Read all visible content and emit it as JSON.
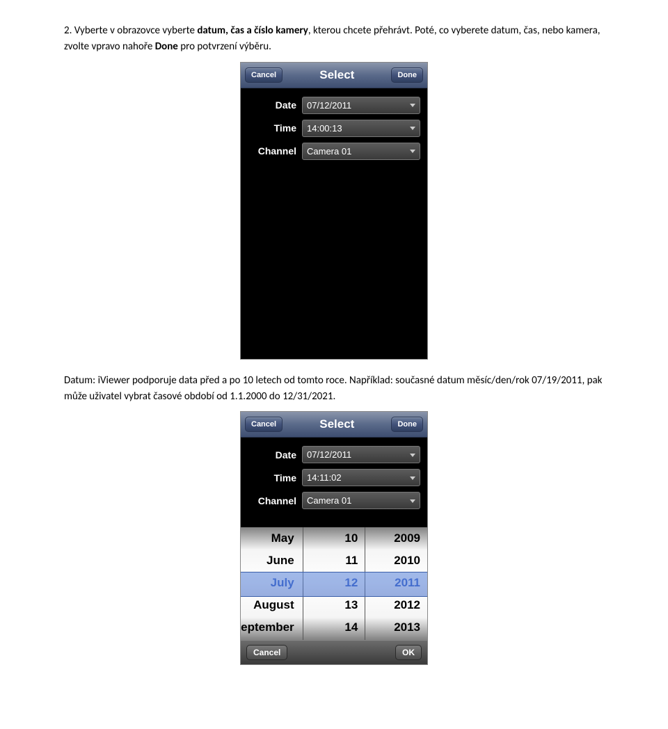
{
  "intro": {
    "prefix": "2. Vyberte v obrazovce vyberte ",
    "bold1": "datum, čas a číslo kamery",
    "mid": ", kterou chcete přehrávt. Poté, co vyberete datum, čas, nebo kamera, zvolte vpravo nahoře ",
    "bold2": "Done",
    "suffix": " pro potvrzení výběru."
  },
  "screen1": {
    "cancel": "Cancel",
    "title": "Select",
    "done": "Done",
    "labels": {
      "date": "Date",
      "time": "Time",
      "channel": "Channel"
    },
    "values": {
      "date": "07/12/2011",
      "time": "14:00:13",
      "channel": "Camera 01"
    }
  },
  "note": "Datum: iViewer podporuje data před a po 10 letech od tomto roce. Například: současné datum měsíc/den/rok 07/19/2011, pak může uživatel vybrat časové období od 1.1.2000 do 12/31/2021.",
  "screen2": {
    "cancel": "Cancel",
    "title": "Select",
    "done": "Done",
    "labels": {
      "date": "Date",
      "time": "Time",
      "channel": "Channel"
    },
    "values": {
      "date": "07/12/2011",
      "time": "14:11:02",
      "channel": "Camera 01"
    },
    "picker": {
      "months": [
        "May",
        "June",
        "July",
        "August",
        "September"
      ],
      "days": [
        "10",
        "11",
        "12",
        "13",
        "14"
      ],
      "years": [
        "2009",
        "2010",
        "2011",
        "2012",
        "2013"
      ]
    },
    "toolbar": {
      "cancel": "Cancel",
      "ok": "OK"
    }
  }
}
